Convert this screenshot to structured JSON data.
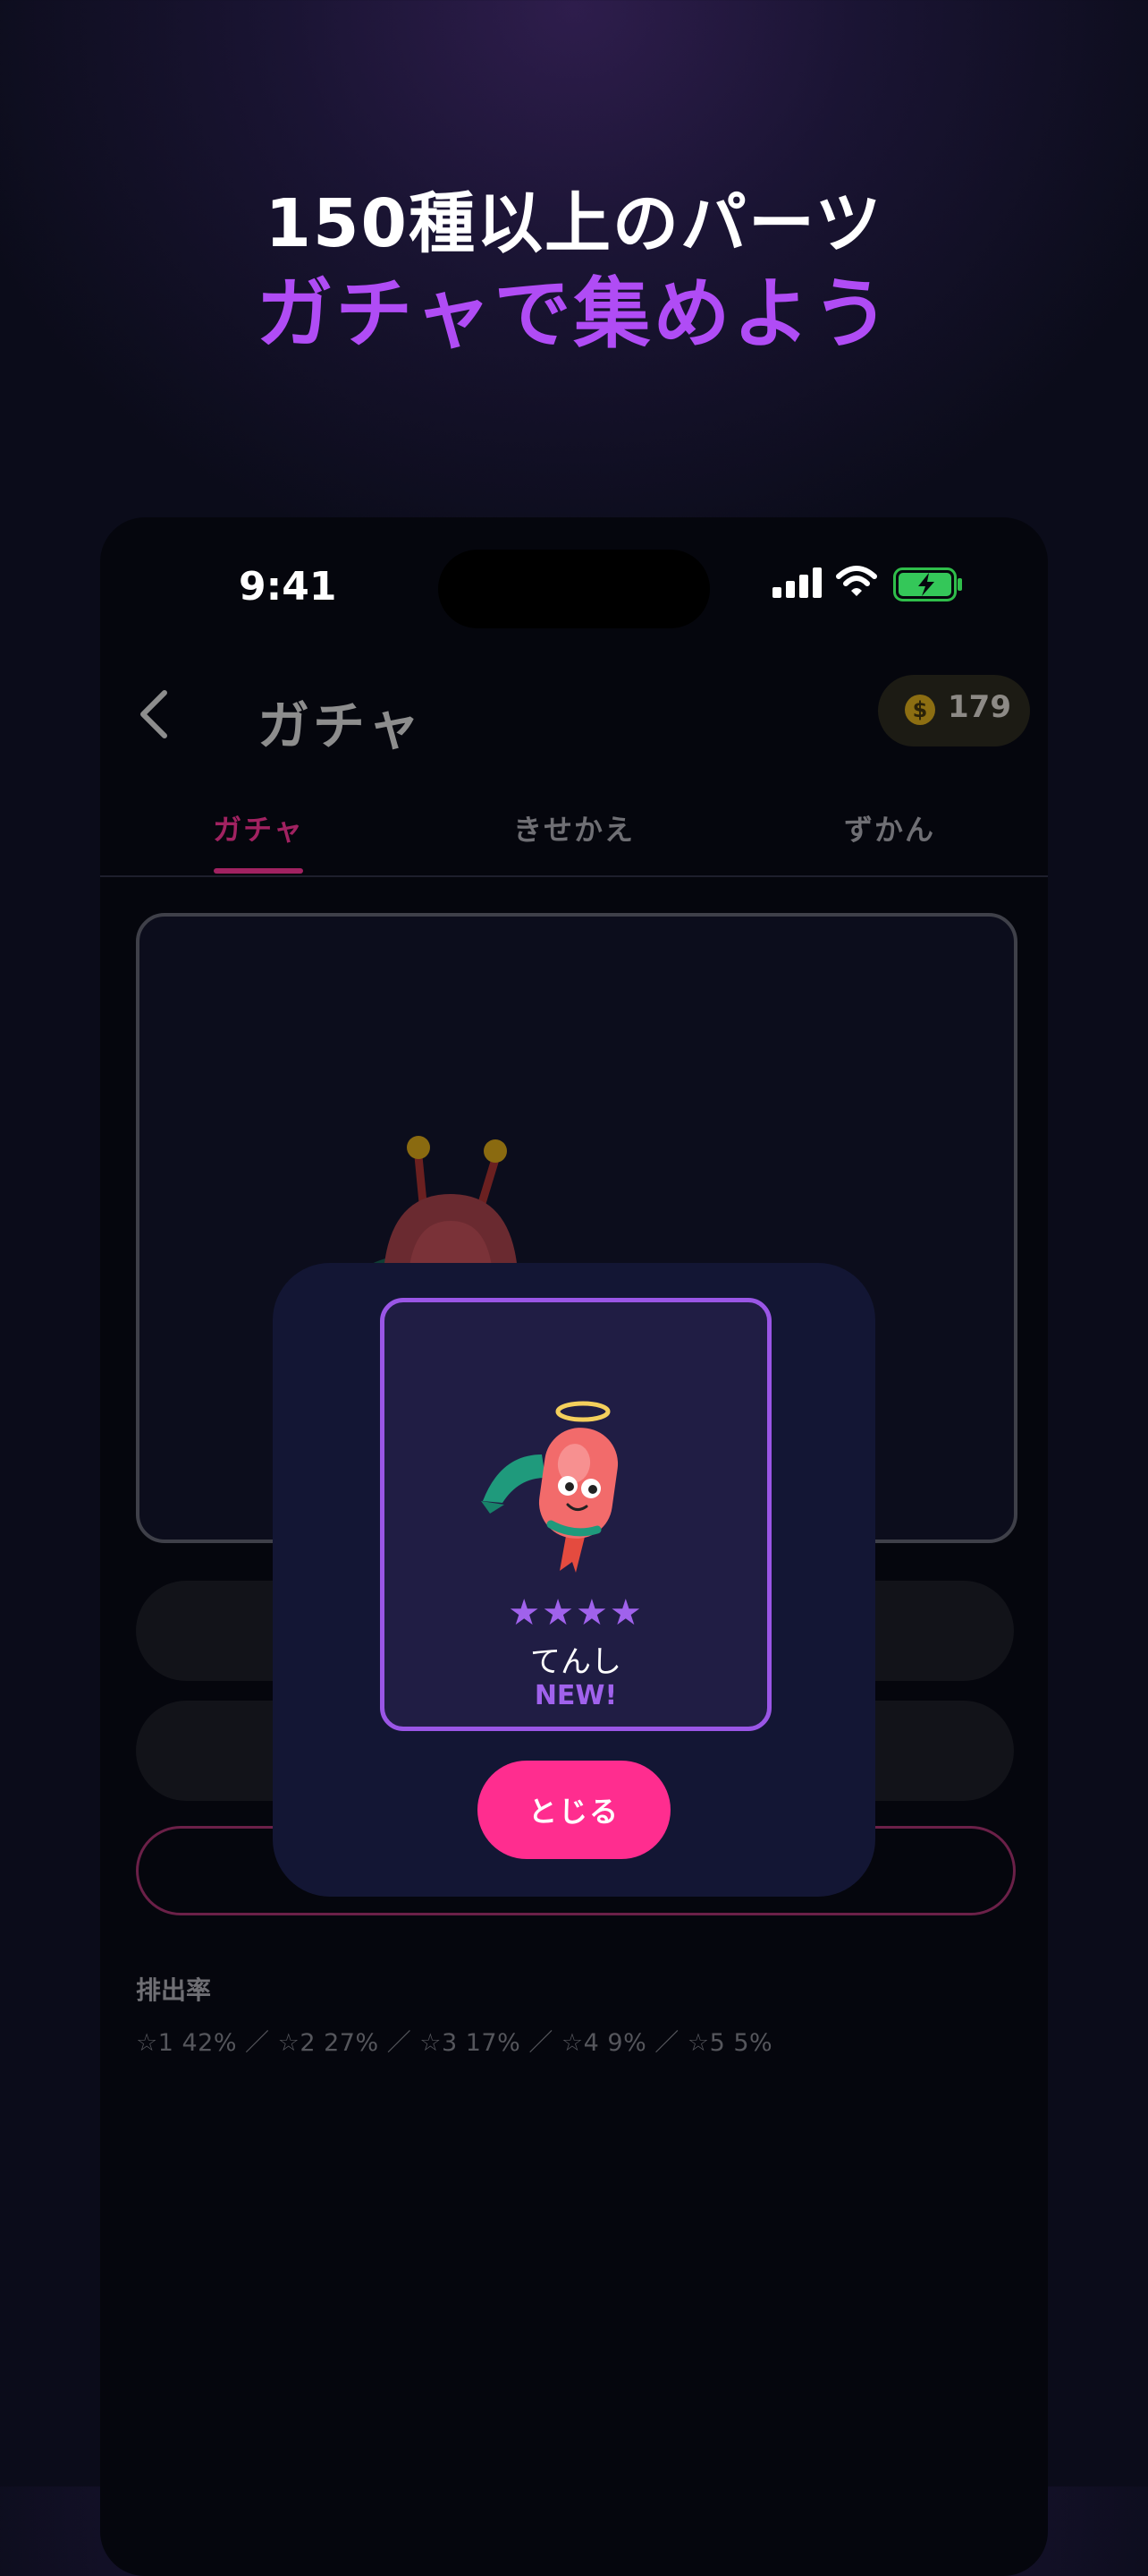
{
  "headline": {
    "line1": "150種以上のパーツ",
    "line2": "ガチャで集めよう"
  },
  "status_bar": {
    "time": "9:41",
    "icons": [
      "cellular-signal-icon",
      "wifi-icon",
      "battery-charging-icon"
    ]
  },
  "nav": {
    "back_icon": "chevron-left-icon",
    "title": "ガチャ",
    "coin_icon": "dollar-coin-icon",
    "coin_count": "179"
  },
  "tabs": [
    {
      "label": "ガチャ",
      "active": true
    },
    {
      "label": "きせかえ",
      "active": false
    },
    {
      "label": "ずかん",
      "active": false
    }
  ],
  "rates": {
    "title": "排出率",
    "text": "☆1 42% ／ ☆2 27% ／ ☆3 17% ／ ☆4 9% ／ ☆5 5%"
  },
  "result_modal": {
    "stars": "★★★★",
    "rarity": 4,
    "part_name": "てんし",
    "badge": "NEW!",
    "close_label": "とじる"
  },
  "colors": {
    "accent_pink": "#ff2d8f",
    "accent_purple": "#b04cf5",
    "card_border": "#9a56e6",
    "tab_active": "#a12261"
  }
}
